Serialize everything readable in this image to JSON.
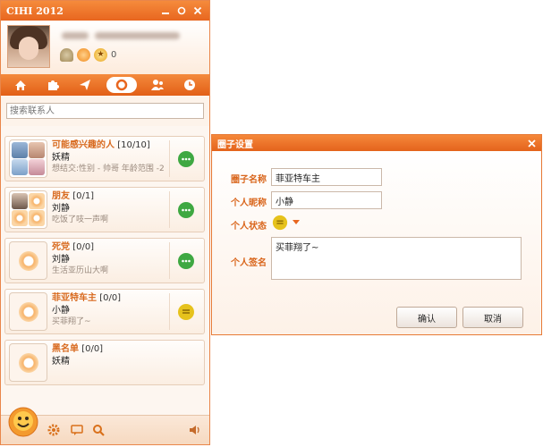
{
  "app": {
    "title": "CIHI 2012"
  },
  "profile": {
    "username": "",
    "email": "",
    "level_count": "0"
  },
  "toolbar": {
    "tabs": [
      {
        "icon": "home-icon"
      },
      {
        "icon": "puzzle-icon"
      },
      {
        "icon": "paper-plane-icon"
      },
      {
        "icon": "circle-icon",
        "active": true
      },
      {
        "icon": "contacts-icon"
      },
      {
        "icon": "clock-icon"
      }
    ]
  },
  "search": {
    "placeholder": "搜索联系人"
  },
  "groups": [
    {
      "name": "可能感兴趣的人",
      "count": "[10/10]",
      "member": "妖精",
      "signature": "想结交:性别 - 帅哥   年龄范围 -2",
      "bubble_color": "#3fa842"
    },
    {
      "name": "朋友",
      "count": "[0/1]",
      "member": "刘静",
      "signature": "吃饭了吱一声啊",
      "bubble_color": "#3fa842"
    },
    {
      "name": "死党",
      "count": "[0/0]",
      "member": "刘静",
      "signature": "生活亚历山大啊",
      "bubble_color": "#3fa842"
    },
    {
      "name": "菲亚特车主",
      "count": "[0/0]",
      "member": "小静",
      "signature": "买菲翔了~",
      "bubble_color": "#e6c21c"
    },
    {
      "name": "黑名单",
      "count": "[0/0]",
      "member": "妖精",
      "signature": "",
      "bubble_color": ""
    }
  ],
  "dialog": {
    "title": "圈子设置",
    "fields": {
      "circle_name_label": "圈子名称",
      "circle_name_value": "菲亚特车主",
      "nickname_label": "个人昵称",
      "nickname_value": "小静",
      "status_label": "个人状态",
      "signature_label": "个人签名",
      "signature_value": "买菲翔了~"
    },
    "confirm_label": "确认",
    "cancel_label": "取消"
  },
  "colors": {
    "accent": "#e8661f",
    "label_orange": "#d9651b",
    "bubble_green": "#3fa842",
    "bubble_yellow": "#e6c21c"
  }
}
